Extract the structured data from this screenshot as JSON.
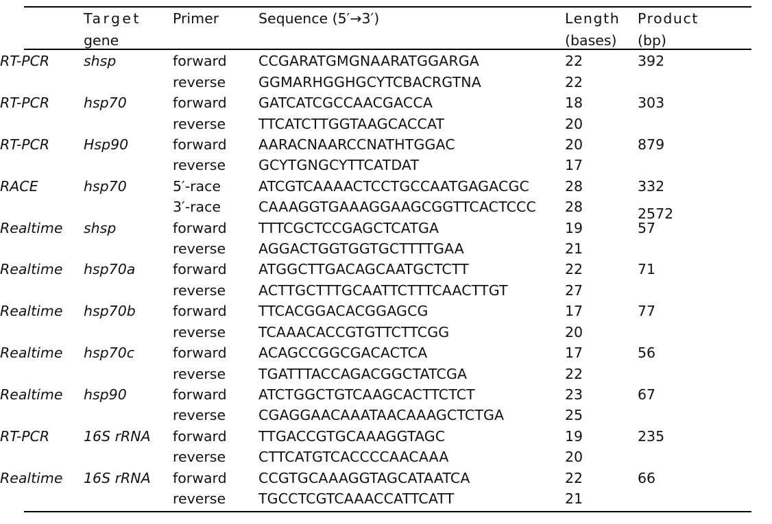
{
  "table": {
    "columns": {
      "method": "",
      "target_gene_line1": "Target",
      "target_gene_line2": "gene",
      "primer": "Primer",
      "sequence": "Sequence (5′→3′)",
      "length_line1": "Length",
      "length_line2": "(bases)",
      "product_line1": "Product",
      "product_line2": "(bp)"
    },
    "rows": [
      {
        "method": "RT-PCR",
        "gene": "shsp",
        "primers": [
          {
            "primer": "forward",
            "sequence": "CCGARATGMGNAARATGGARGA",
            "length": "22",
            "product": "392"
          },
          {
            "primer": "reverse",
            "sequence": "GGMARHGGHGCYTCBACRGTNA",
            "length": "22",
            "product": ""
          }
        ]
      },
      {
        "method": "RT-PCR",
        "gene": "hsp70",
        "primers": [
          {
            "primer": "forward",
            "sequence": "GATCATCGCCAACGACCA",
            "length": "18",
            "product": "303"
          },
          {
            "primer": "reverse",
            "sequence": "TTCATCTTGGTAAGCACCAT",
            "length": "20",
            "product": ""
          }
        ]
      },
      {
        "method": "RT-PCR",
        "gene": "Hsp90",
        "primers": [
          {
            "primer": "forward",
            "sequence": "AARACNAARCCNATHTGGAC",
            "length": "20",
            "product": "879"
          },
          {
            "primer": "reverse",
            "sequence": "GCYTGNGCYTTCATDAT",
            "length": "17",
            "product": ""
          }
        ]
      },
      {
        "method": "RACE",
        "gene": "hsp70",
        "primers": [
          {
            "primer": "5′-race",
            "sequence": "ATCGTCAAAACTCCTGCCAATGAGACGC",
            "length": "28",
            "product": "332"
          },
          {
            "primer": "3′-race",
            "sequence": "CAAAGGTGAAAGGAAGCGGTTCACTCCC",
            "length": "28",
            "product": "2572",
            "product_lowered": true
          }
        ]
      },
      {
        "method": "Realtime",
        "gene": "shsp",
        "primers": [
          {
            "primer": "forward",
            "sequence": "TTTCGCTCCGAGCTCATGA",
            "length": "19",
            "product": "57"
          },
          {
            "primer": "reverse",
            "sequence": "AGGACTGGTGGTGCTTTTGAA",
            "length": "21",
            "product": ""
          }
        ]
      },
      {
        "method": "Realtime",
        "gene": "hsp70a",
        "primers": [
          {
            "primer": "forward",
            "sequence": "ATGGCTTGACAGCAATGCTCTT",
            "length": "22",
            "product": "71"
          },
          {
            "primer": "reverse",
            "sequence": "ACTTGCTTTGCAATTCTTTCAACTTGT",
            "length": "27",
            "product": ""
          }
        ]
      },
      {
        "method": "Realtime",
        "gene": "hsp70b",
        "primers": [
          {
            "primer": "forward",
            "sequence": "TTCACGGACACGGAGCG",
            "length": "17",
            "product": "77"
          },
          {
            "primer": "reverse",
            "sequence": "TCAAACACCGTGTTCTTCGG",
            "length": "20",
            "product": ""
          }
        ]
      },
      {
        "method": "Realtime",
        "gene": "hsp70c",
        "primers": [
          {
            "primer": "forward",
            "sequence": "ACAGCCGGCGACACTCA",
            "length": "17",
            "product": "56"
          },
          {
            "primer": "reverse",
            "sequence": "TGATTTACCAGACGGCTATCGA",
            "length": "22",
            "product": ""
          }
        ]
      },
      {
        "method": "Realtime",
        "gene": "hsp90",
        "primers": [
          {
            "primer": "forward",
            "sequence": "ATCTGGCTGTCAAGCACTTCTCT",
            "length": "23",
            "product": "67"
          },
          {
            "primer": "reverse",
            "sequence": "CGAGGAACAAATAACAAAGCTCTGA",
            "length": "25",
            "product": ""
          }
        ]
      },
      {
        "method": "RT-PCR",
        "gene": "16S rRNA",
        "primers": [
          {
            "primer": "forward",
            "sequence": "TTGACCGTGCAAAGGTAGC",
            "length": "19",
            "product": "235"
          },
          {
            "primer": "reverse",
            "sequence": "CTTCATGTCACCCCAACAAA",
            "length": "20",
            "product": ""
          }
        ]
      },
      {
        "method": "Realtime",
        "gene": "16S rRNA",
        "primers": [
          {
            "primer": "forward",
            "sequence": "CCGTGCAAAGGTAGCATAATCA",
            "length": "22",
            "product": "66"
          },
          {
            "primer": "reverse",
            "sequence": "TGCCTCGTCAAACCATTCATT",
            "length": "21",
            "product": ""
          }
        ]
      }
    ]
  }
}
